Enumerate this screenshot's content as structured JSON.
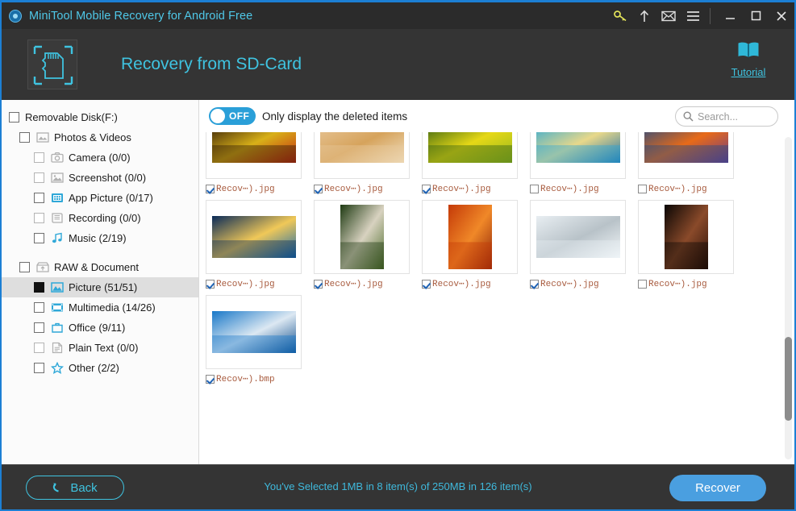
{
  "window": {
    "title": "MiniTool Mobile Recovery for Android Free",
    "logo_icon": "app-logo-icon",
    "titlebar_icons": [
      "key-icon",
      "upload-arrow-icon",
      "envelope-icon",
      "hamburger-menu-icon"
    ],
    "minimize": "minimize-icon",
    "maximize": "maximize-icon",
    "close": "close-icon"
  },
  "header": {
    "icon": "sd-card-icon",
    "title": "Recovery from SD-Card",
    "tutorial_label": "Tutorial",
    "tutorial_icon": "book-icon"
  },
  "sidebar": {
    "items": [
      {
        "label": "Removable Disk(F:)",
        "level": 0,
        "check": "empty",
        "icon": null,
        "selected": false
      },
      {
        "label": "Photos & Videos",
        "level": 1,
        "check": "empty",
        "icon": "photos-videos-icon",
        "selected": false
      },
      {
        "label": "Camera (0/0)",
        "level": 2,
        "check": "dim",
        "icon": "camera-icon",
        "selected": false
      },
      {
        "label": "Screenshot (0/0)",
        "level": 2,
        "check": "dim",
        "icon": "screenshot-icon",
        "selected": false
      },
      {
        "label": "App Picture (0/17)",
        "level": 2,
        "check": "empty",
        "icon": "app-picture-icon",
        "selected": false
      },
      {
        "label": "Recording (0/0)",
        "level": 2,
        "check": "dim",
        "icon": "recording-icon",
        "selected": false
      },
      {
        "label": "Music (2/19)",
        "level": 2,
        "check": "empty",
        "icon": "music-icon",
        "selected": false
      },
      {
        "label": "RAW & Document",
        "level": 1,
        "check": "empty",
        "icon": "raw-document-icon",
        "selected": false,
        "gap_before": true
      },
      {
        "label": "Picture (51/51)",
        "level": 2,
        "check": "full",
        "icon": "picture-icon",
        "selected": true
      },
      {
        "label": "Multimedia (14/26)",
        "level": 2,
        "check": "empty",
        "icon": "multimedia-icon",
        "selected": false
      },
      {
        "label": "Office (9/11)",
        "level": 2,
        "check": "empty",
        "icon": "office-icon",
        "selected": false
      },
      {
        "label": "Plain Text (0/0)",
        "level": 2,
        "check": "dim",
        "icon": "plain-text-icon",
        "selected": false
      },
      {
        "label": "Other (2/2)",
        "level": 2,
        "check": "empty",
        "icon": "star-icon",
        "selected": false
      }
    ]
  },
  "toolbar": {
    "toggle_state": "OFF",
    "toggle_label": "Only display the deleted items",
    "search_placeholder": "Search...",
    "search_value": "",
    "search_icon": "search-icon"
  },
  "files": [
    {
      "name": "Recov⋯).jpg",
      "checked": true,
      "shape": "w",
      "c1": "#2b1608",
      "c2": "#d8b018",
      "c3": "#c42a12"
    },
    {
      "name": "Recov⋯).jpg",
      "checked": true,
      "shape": "w",
      "c1": "#e8c79a",
      "c2": "#d6a35c",
      "c3": "#f0e0c2"
    },
    {
      "name": "Recov⋯).jpg",
      "checked": true,
      "shape": "w",
      "c1": "#2e5c12",
      "c2": "#e6d816",
      "c3": "#95b820"
    },
    {
      "name": "Recov⋯).jpg",
      "checked": false,
      "shape": "w",
      "c1": "#2aa8d8",
      "c2": "#e8d88a",
      "c3": "#1c6ea8"
    },
    {
      "name": "Recov⋯).jpg",
      "checked": false,
      "shape": "w",
      "c1": "#1a4a88",
      "c2": "#e86a18",
      "c3": "#6a3a8a"
    },
    {
      "name": "Recov⋯).jpg",
      "checked": true,
      "shape": "w",
      "c1": "#0a2a58",
      "c2": "#f0c858",
      "c3": "#1268b0"
    },
    {
      "name": "Recov⋯).jpg",
      "checked": true,
      "shape": "t",
      "c1": "#1e3a12",
      "c2": "#d8d2c0",
      "c3": "#4a6a28"
    },
    {
      "name": "Recov⋯).jpg",
      "checked": true,
      "shape": "t",
      "c1": "#c43a08",
      "c2": "#f08828",
      "c3": "#8a2008"
    },
    {
      "name": "Recov⋯).jpg",
      "checked": true,
      "shape": "w",
      "c1": "#e8eef2",
      "c2": "#b8c2c8",
      "c3": "#f4f8fa"
    },
    {
      "name": "Recov⋯).jpg",
      "checked": false,
      "shape": "t",
      "c1": "#0a0604",
      "c2": "#8a4a2a",
      "c3": "#2a1008"
    },
    {
      "name": "Recov⋯).bmp",
      "checked": true,
      "shape": "w",
      "c1": "#1878c8",
      "c2": "#dce8f2",
      "c3": "#0a4a8a"
    }
  ],
  "footer": {
    "back_label": "Back",
    "back_icon": "back-arrow-icon",
    "status": "You've Selected 1MB in 8 item(s) of 250MB in 126 item(s)",
    "recover_label": "Recover"
  },
  "colors": {
    "accent_cyan": "#3fc3e0",
    "accent_blue": "#4a9fe0",
    "chrome_dark": "#343434",
    "titlebar": "#2b2b2b",
    "border_blue": "#1c7fd4"
  }
}
